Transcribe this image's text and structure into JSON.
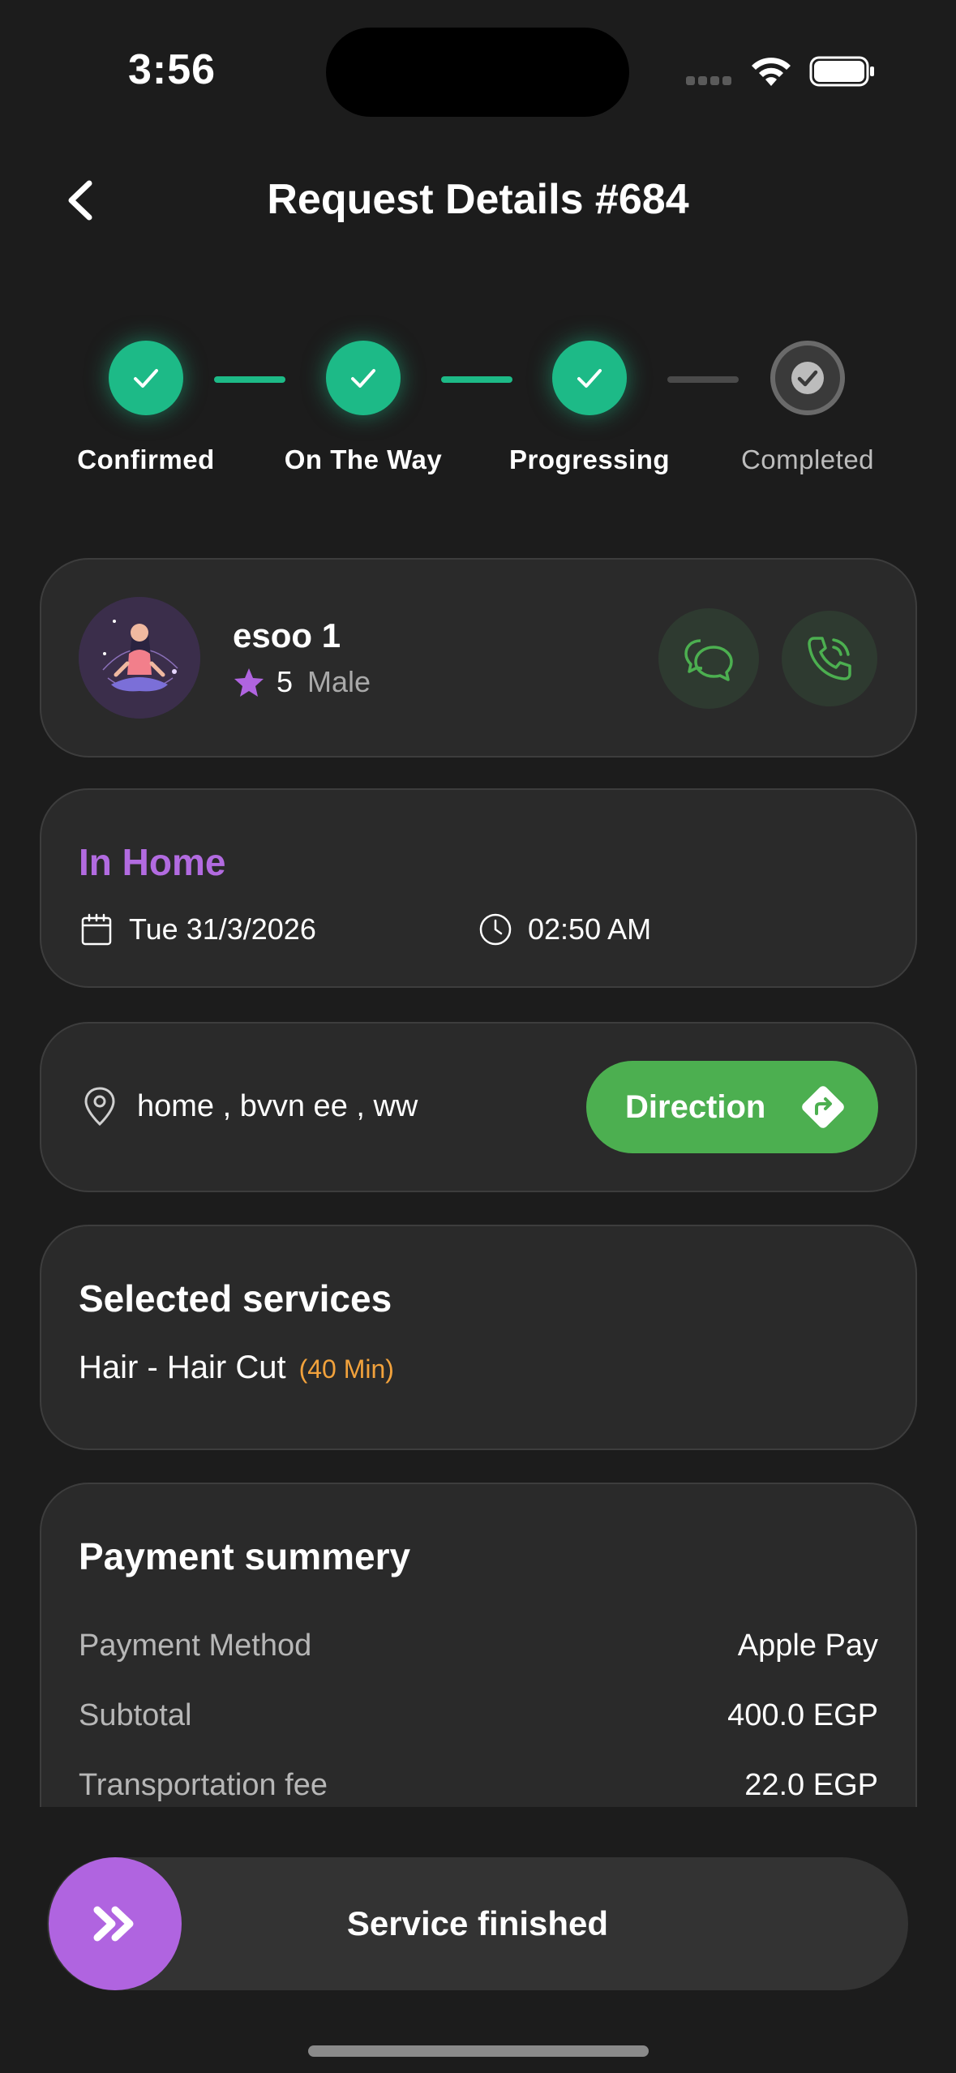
{
  "status_bar": {
    "time": "3:56"
  },
  "header": {
    "title": "Request Details #684"
  },
  "stepper": {
    "steps": [
      {
        "label": "Confirmed",
        "state": "done"
      },
      {
        "label": "On The Way",
        "state": "done"
      },
      {
        "label": "Progressing",
        "state": "done"
      },
      {
        "label": "Completed",
        "state": "pending"
      }
    ]
  },
  "provider": {
    "name": "esoo 1",
    "rating": "5",
    "gender": "Male"
  },
  "appointment": {
    "location_type": "In Home",
    "date": "Tue 31/3/2026",
    "time": "02:50 AM"
  },
  "address": {
    "text": "home , bvvn ee , ww",
    "direction_label": "Direction"
  },
  "services": {
    "title": "Selected services",
    "items": [
      {
        "name": "Hair - Hair Cut",
        "duration": "(40 Min)"
      }
    ]
  },
  "payment": {
    "title": "Payment summery",
    "rows": [
      {
        "label": "Payment Method",
        "value": "Apple Pay"
      },
      {
        "label": "Subtotal",
        "value": "400.0 EGP"
      },
      {
        "label": "Transportation fee",
        "value": "22.0 EGP"
      }
    ]
  },
  "action": {
    "slider_label": "Service finished"
  },
  "colors": {
    "accent_green": "#1dba87",
    "direction_green": "#4caf50",
    "purple": "#b064e0",
    "orange": "#f2a23c",
    "background": "#1c1c1c",
    "card": "#2a2a2a"
  }
}
